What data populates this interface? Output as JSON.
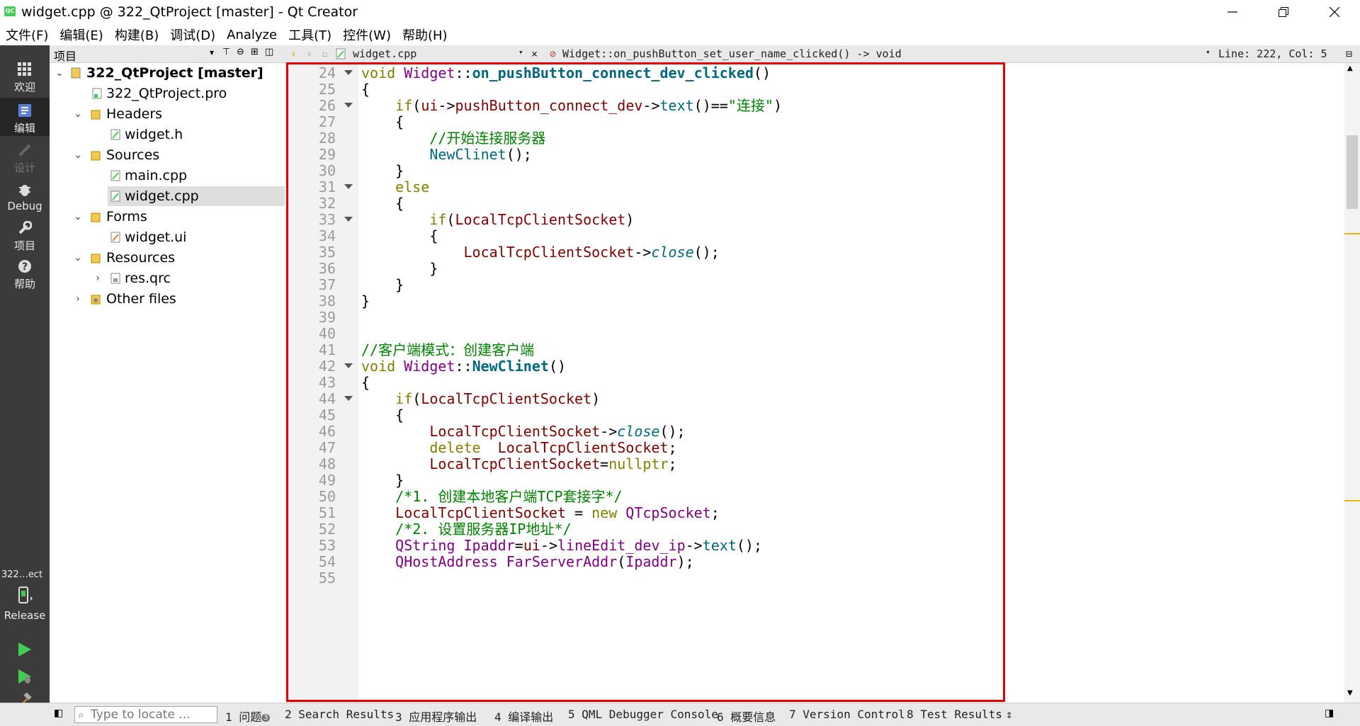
{
  "window": {
    "title": "widget.cpp @ 322_QtProject [master] - Qt Creator",
    "logo_text": "QC"
  },
  "menu": [
    "文件(F)",
    "编辑(E)",
    "构建(B)",
    "调试(D)",
    "Analyze",
    "工具(T)",
    "控件(W)",
    "帮助(H)"
  ],
  "modes": {
    "welcome": "欢迎",
    "edit": "编辑",
    "design": "设计",
    "debug": "Debug",
    "projects": "项目",
    "help": "帮助",
    "kit_project": "322…ect",
    "kit_config": "Release"
  },
  "project_pane": {
    "title": "项目",
    "tree": [
      {
        "label": "322_QtProject [master]",
        "bold": true
      },
      {
        "label": "322_QtProject.pro"
      },
      {
        "label": "Headers"
      },
      {
        "label": "widget.h"
      },
      {
        "label": "Sources"
      },
      {
        "label": "main.cpp"
      },
      {
        "label": "widget.cpp",
        "selected": true
      },
      {
        "label": "Forms"
      },
      {
        "label": "widget.ui"
      },
      {
        "label": "Resources"
      },
      {
        "label": "res.qrc"
      },
      {
        "label": "Other files"
      }
    ]
  },
  "editor_toolbar": {
    "file": "widget.cpp",
    "symbol": "Widget::on_pushButton_set_user_name_clicked() -> void",
    "position": "Line: 222, Col: 5"
  },
  "code_lines": [
    {
      "n": "24",
      "fold": true
    },
    {
      "n": "25"
    },
    {
      "n": "26",
      "fold": true
    },
    {
      "n": "27"
    },
    {
      "n": "28"
    },
    {
      "n": "29"
    },
    {
      "n": "30"
    },
    {
      "n": "31",
      "fold": true
    },
    {
      "n": "32"
    },
    {
      "n": "33",
      "fold": true
    },
    {
      "n": "34"
    },
    {
      "n": "35"
    },
    {
      "n": "36"
    },
    {
      "n": "37"
    },
    {
      "n": "38"
    },
    {
      "n": "39"
    },
    {
      "n": "40"
    },
    {
      "n": "41"
    },
    {
      "n": "42",
      "fold": true
    },
    {
      "n": "43"
    },
    {
      "n": "44",
      "fold": true
    },
    {
      "n": "45"
    },
    {
      "n": "46"
    },
    {
      "n": "47"
    },
    {
      "n": "48"
    },
    {
      "n": "49"
    },
    {
      "n": "50"
    },
    {
      "n": "51"
    },
    {
      "n": "52"
    },
    {
      "n": "53"
    },
    {
      "n": "54"
    },
    {
      "n": "55"
    }
  ],
  "code": {
    "l24": [
      "void",
      " ",
      "Widget",
      "::",
      "on_pushButton_connect_dev_clicked",
      "()"
    ],
    "l25": "{",
    "l26": [
      "    ",
      "if",
      "(",
      "ui",
      "->",
      "pushButton_connect_dev",
      "->",
      "text",
      "()==",
      "\"连接\"",
      ")"
    ],
    "l27": "    {",
    "l28": "        //开始连接服务器",
    "l29": [
      "        ",
      "NewClinet",
      "();"
    ],
    "l30": "    }",
    "l31": [
      "    ",
      "else"
    ],
    "l32": "    {",
    "l33": [
      "        ",
      "if",
      "(",
      "LocalTcpClientSocket",
      ")"
    ],
    "l34": "        {",
    "l35": [
      "            ",
      "LocalTcpClientSocket",
      "->",
      "close",
      "();"
    ],
    "l36": "        }",
    "l37": "    }",
    "l38": "}",
    "l39": "",
    "l40": "",
    "l41": "//客户端模式：创建客户端",
    "l42": [
      "void",
      " ",
      "Widget",
      "::",
      "NewClinet",
      "()"
    ],
    "l43": "{",
    "l44": [
      "    ",
      "if",
      "(",
      "LocalTcpClientSocket",
      ")"
    ],
    "l45": "    {",
    "l46": [
      "        ",
      "LocalTcpClientSocket",
      "->",
      "close",
      "();"
    ],
    "l47": [
      "        ",
      "delete",
      "  ",
      "LocalTcpClientSocket",
      ";"
    ],
    "l48": [
      "        ",
      "LocalTcpClientSocket",
      "=",
      "nullptr",
      ";"
    ],
    "l49": "    }",
    "l50": "    /*1. 创建本地客户端TCP套接字*/",
    "l51": [
      "    ",
      "LocalTcpClientSocket",
      " = ",
      "new",
      " ",
      "QTcpSocket",
      ";"
    ],
    "l52": "    /*2. 设置服务器IP地址*/",
    "l53": [
      "    ",
      "QString",
      " ",
      "Ipaddr",
      "=",
      "ui",
      "->",
      "lineEdit_dev_ip",
      "->",
      "text",
      "();"
    ],
    "l54": [
      "    ",
      "QHostAddress",
      " ",
      "FarServerAddr",
      "(",
      "Ipaddr",
      ");"
    ],
    "l55": ""
  },
  "status_bar": {
    "locate_placeholder": "Type to locate ...",
    "tabs": [
      "1 问题",
      "2 Search Results",
      "3 应用程序输出",
      "4 编译输出",
      "5 QML Debugger Console",
      "6 概要信息",
      "7 Version Control",
      "8 Test Results"
    ],
    "issues_badge": "3"
  },
  "colors": {
    "highlight_border": "#e00000",
    "keyword": "#808000",
    "type": "#800080",
    "function": "#00677c",
    "member": "#800000",
    "comment": "#008000"
  }
}
